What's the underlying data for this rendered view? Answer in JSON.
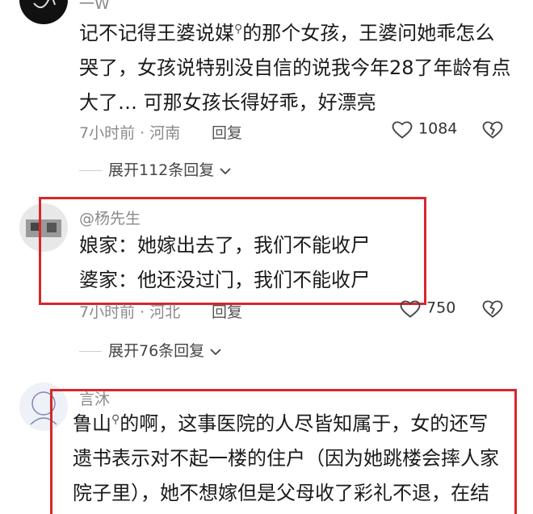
{
  "comments": [
    {
      "username": "一W",
      "lines": [
        "记不记得王婆说媒",
        "的那个女孩，王婆问她乖怎么",
        "哭了，女孩说特别没自信的说我今年28了年龄有点",
        "大了… 可那女孩长得好乖，好漂亮"
      ],
      "time": "7小时前",
      "location": "河南",
      "reply_label": "回复",
      "likes": "1084",
      "expand_label": "展开112条回复"
    },
    {
      "username": "@杨先生",
      "lines": [
        "娘家：她嫁出去了，我们不能收尸",
        "婆家：他还没过门，我们不能收尸"
      ],
      "time": "7小时前",
      "location": "河北",
      "reply_label": "回复",
      "likes": "750",
      "expand_label": "展开76条回复"
    },
    {
      "username": "言沐",
      "lines": [
        "鲁山",
        "的啊，这事医院的人尽皆知属于，女的还写",
        "遗书表示对不起一楼的住户（因为她跳楼会摔人家",
        "院子里），她不想嫁但是父母收了彩礼不退，在结"
      ]
    }
  ],
  "colors": {
    "highlight": "#d8262c",
    "meta": "#8a8a8a"
  },
  "icons": [
    "search-mark-icon",
    "heart-icon",
    "broken-heart-icon",
    "chevron-down-icon"
  ]
}
